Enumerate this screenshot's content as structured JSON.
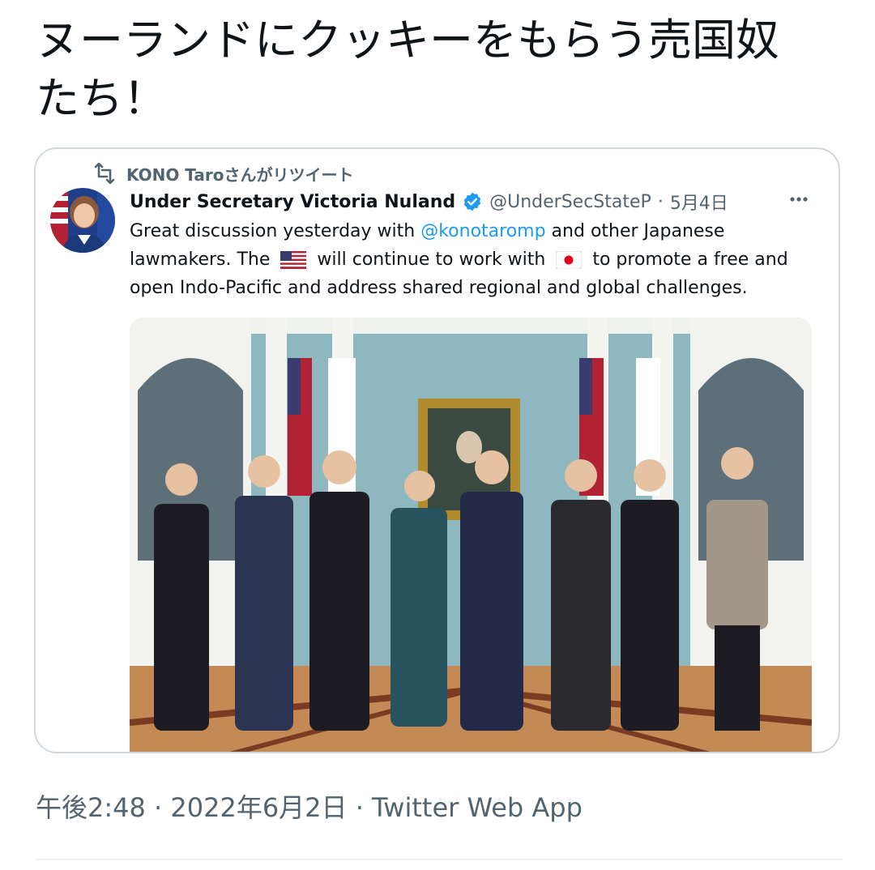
{
  "tweet": {
    "text_line1": "ヌーランドにクッキーをもらう売国奴",
    "text_line2": "たち！"
  },
  "quote": {
    "retweeted_by": "KONO Taroさんがリツイート",
    "display_name": "Under Secretary Victoria Nuland",
    "handle": "@UnderSecStateP",
    "separator": "·",
    "date": "5月4日",
    "body_part1": "Great discussion yesterday with ",
    "mention": "@konotaromp",
    "body_part2": " and other Japanese lawmakers. The ",
    "body_part3": " will continue to work with ",
    "body_part4": " to promote a free and open Indo-Pacific and address shared regional and global challenges.",
    "flag_1": "us-flag-emoji",
    "flag_2": "japan-flag-emoji"
  },
  "footer": {
    "meta": "午後2:48 · 2022年6月2日 · Twitter Web App"
  },
  "colors": {
    "link": "#1d9bf0",
    "secondary_text": "#536471",
    "border": "#cfd9de",
    "verified": "#1d9bf0"
  }
}
